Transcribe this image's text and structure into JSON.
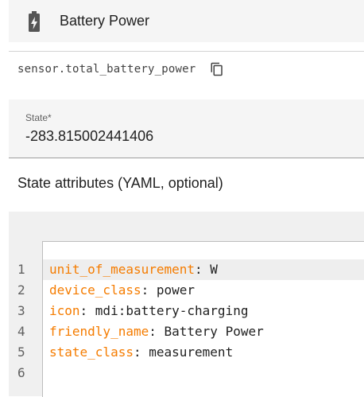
{
  "header": {
    "title": "Battery Power",
    "icon": "battery-charging-icon"
  },
  "entity": {
    "id": "sensor.total_battery_power",
    "copy_icon": "copy-icon"
  },
  "state": {
    "label": "State*",
    "value": "-283.815002441406"
  },
  "attributes": {
    "heading": "State attributes (YAML, optional)",
    "lines": [
      {
        "num": "1",
        "key": "unit_of_measurement",
        "sep": ": ",
        "value": "W"
      },
      {
        "num": "2",
        "key": "device_class",
        "sep": ": ",
        "value": "power"
      },
      {
        "num": "3",
        "key": "icon",
        "sep": ": ",
        "value": "mdi:battery-charging"
      },
      {
        "num": "4",
        "key": "friendly_name",
        "sep": ": ",
        "value": "Battery Power"
      },
      {
        "num": "5",
        "key": "state_class",
        "sep": ": ",
        "value": "measurement"
      },
      {
        "num": "6",
        "key": "",
        "sep": "",
        "value": ""
      }
    ]
  },
  "colors": {
    "key": "#f57c00",
    "text": "#212121",
    "panel": "#f5f5f5"
  }
}
